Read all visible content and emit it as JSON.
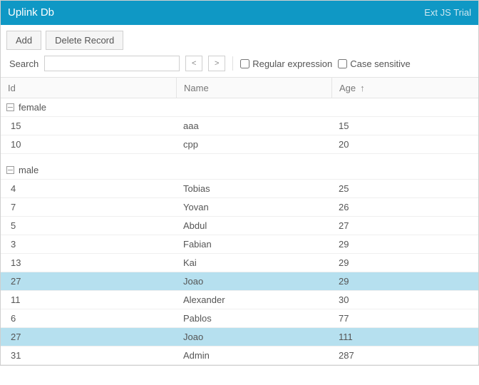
{
  "header": {
    "title": "Uplink Db",
    "trial": "Ext JS Trial"
  },
  "toolbar": {
    "add": "Add",
    "delete": "Delete Record"
  },
  "search": {
    "label": "Search",
    "value": "",
    "prev": "<",
    "next": ">",
    "regex_label": "Regular expression",
    "case_label": "Case sensitive"
  },
  "columns": {
    "id": "Id",
    "name": "Name",
    "age": "Age",
    "sort_arrow": "↑"
  },
  "groups": [
    {
      "label": "female",
      "rows": [
        {
          "id": "15",
          "name": "aaa",
          "age": "15",
          "selected": false
        },
        {
          "id": "10",
          "name": "cpp",
          "age": "20",
          "selected": false
        }
      ]
    },
    {
      "label": "male",
      "rows": [
        {
          "id": "4",
          "name": "Tobias",
          "age": "25",
          "selected": false
        },
        {
          "id": "7",
          "name": "Yovan",
          "age": "26",
          "selected": false
        },
        {
          "id": "5",
          "name": "Abdul",
          "age": "27",
          "selected": false
        },
        {
          "id": "3",
          "name": "Fabian",
          "age": "29",
          "selected": false
        },
        {
          "id": "13",
          "name": "Kai",
          "age": "29",
          "selected": false
        },
        {
          "id": "27",
          "name": "Joao",
          "age": "29",
          "selected": true
        },
        {
          "id": "11",
          "name": "Alexander",
          "age": "30",
          "selected": false
        },
        {
          "id": "6",
          "name": "Pablos",
          "age": "77",
          "selected": false
        },
        {
          "id": "27",
          "name": "Joao",
          "age": "111",
          "selected": true
        },
        {
          "id": "31",
          "name": "Admin",
          "age": "287",
          "selected": false
        }
      ]
    }
  ]
}
